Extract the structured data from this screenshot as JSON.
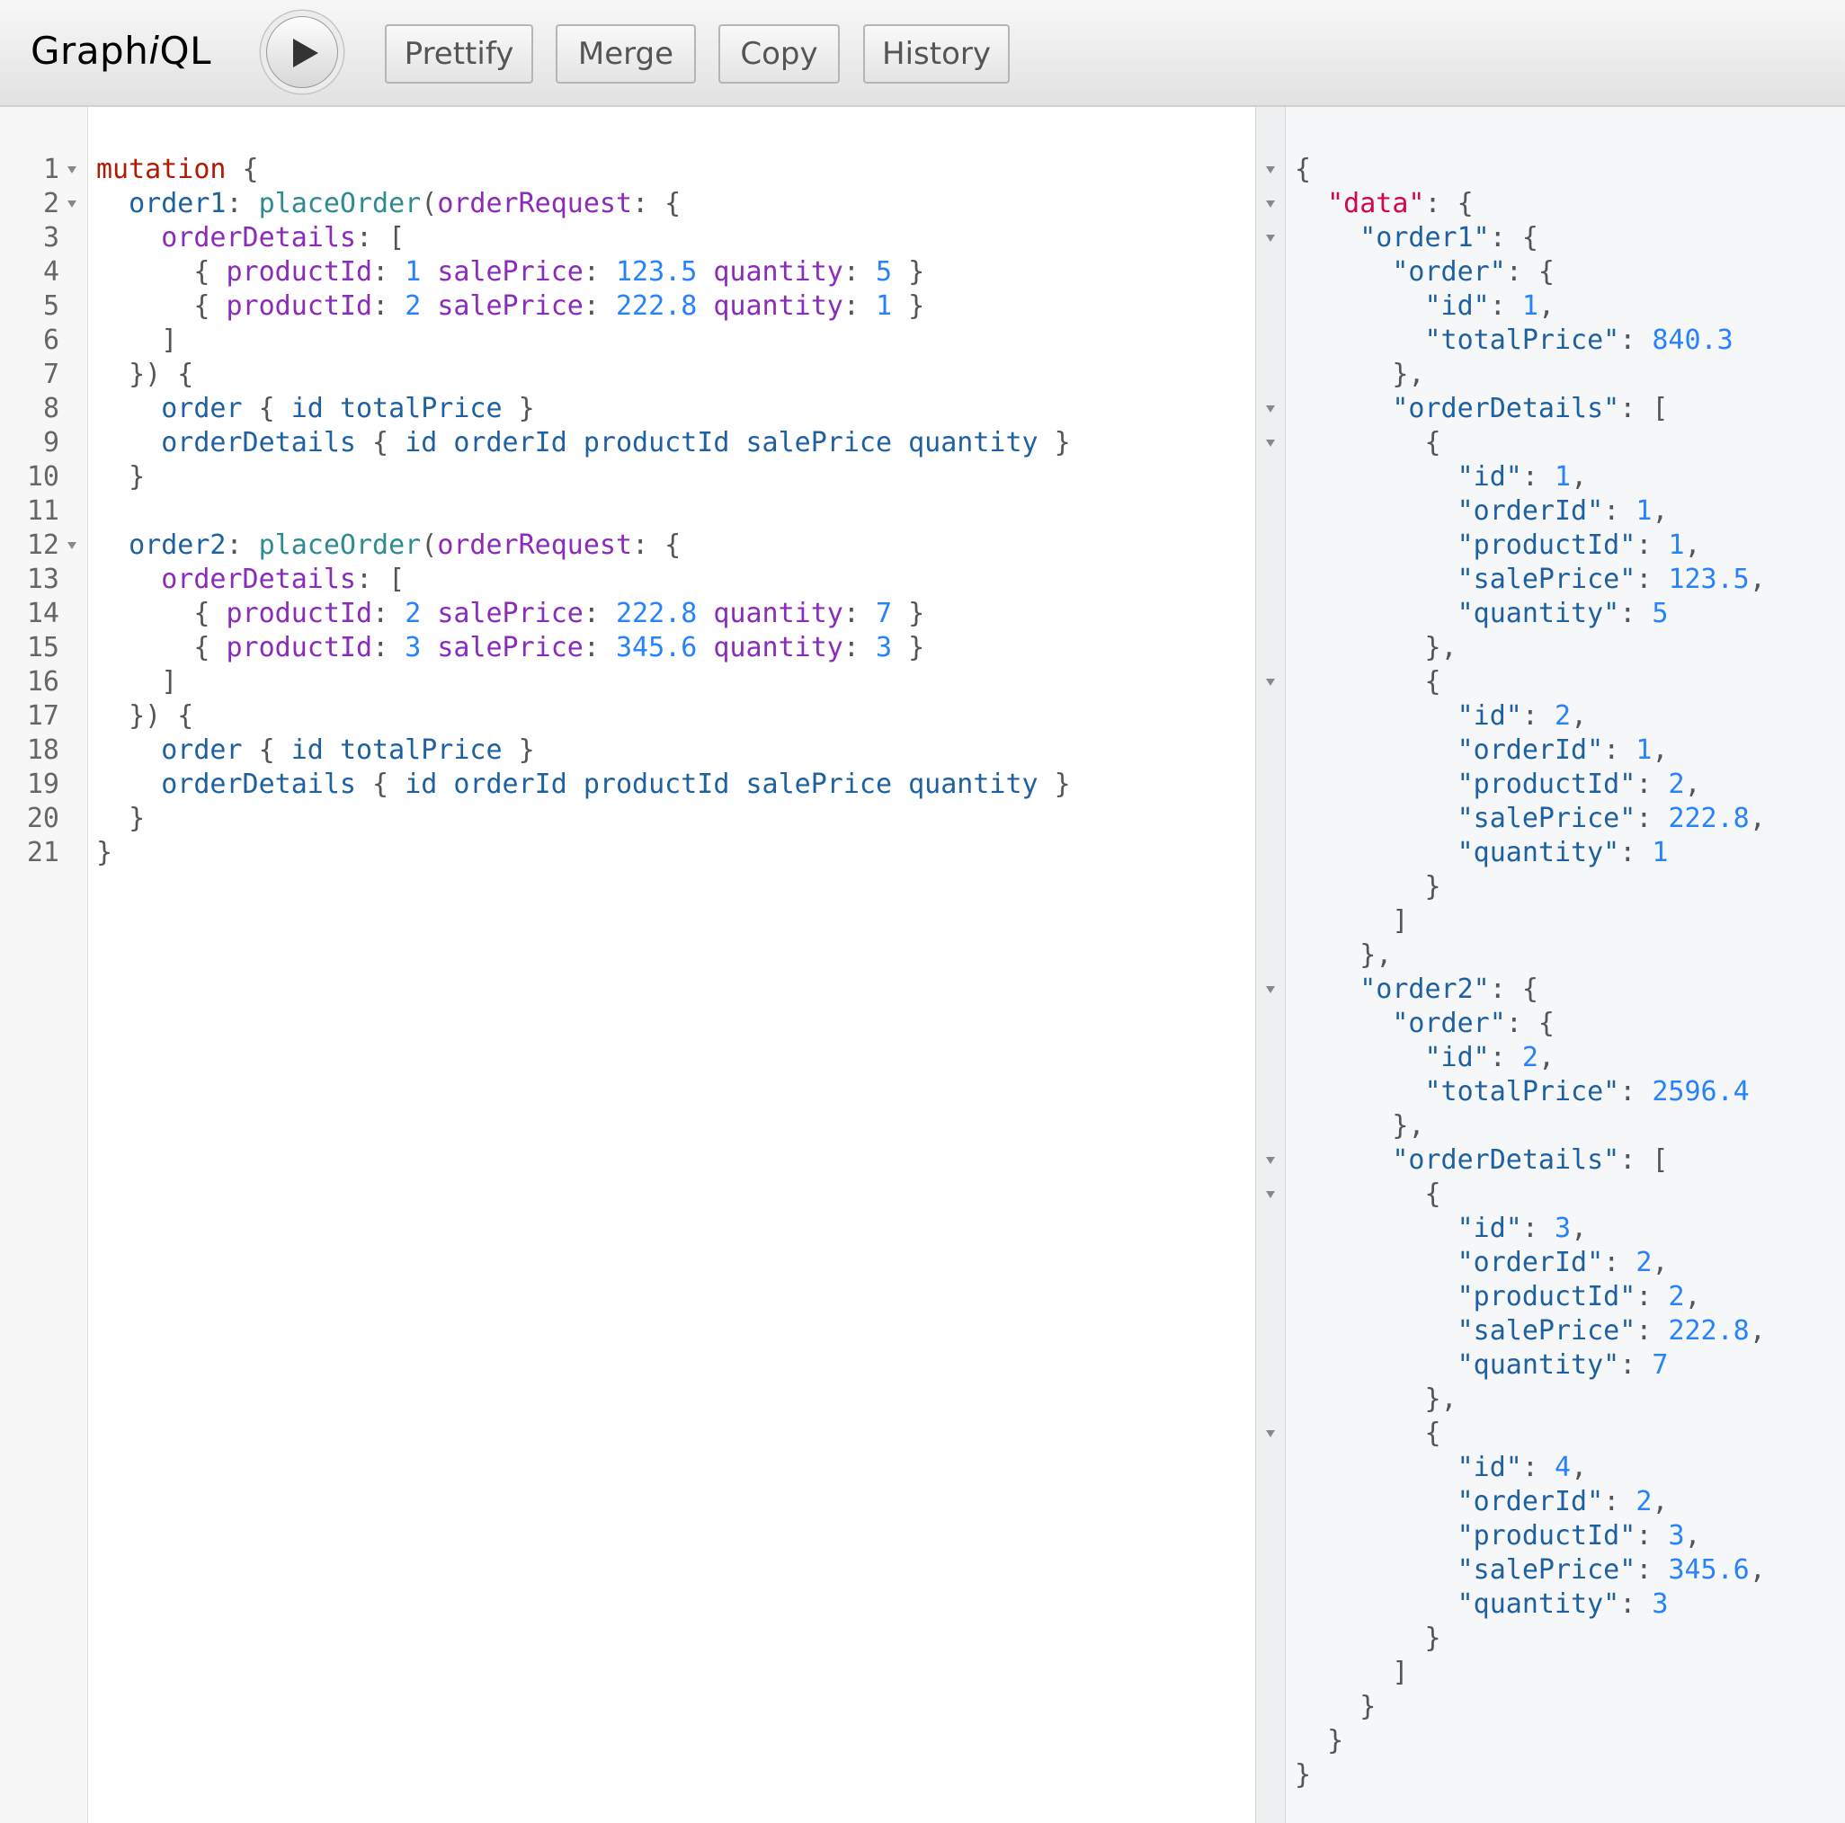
{
  "toolbar": {
    "logo_pre": "Graph",
    "logo_i": "i",
    "logo_post": "QL",
    "run_icon": "play-icon",
    "prettify": "Prettify",
    "merge": "Merge",
    "copy": "Copy",
    "history": "History"
  },
  "query_lines": [
    "mutation {",
    "  order1: placeOrder(orderRequest: {",
    "    orderDetails: [",
    "      { productId: 1 salePrice: 123.5 quantity: 5 }",
    "      { productId: 2 salePrice: 222.8 quantity: 1 }",
    "    ]",
    "  }) {",
    "    order { id totalPrice }",
    "    orderDetails { id orderId productId salePrice quantity }",
    "  }",
    "",
    "  order2: placeOrder(orderRequest: {",
    "    orderDetails: [",
    "      { productId: 2 salePrice: 222.8 quantity: 7 }",
    "      { productId: 3 salePrice: 345.6 quantity: 3 }",
    "    ]",
    "  }) {",
    "    order { id totalPrice }",
    "    orderDetails { id orderId productId salePrice quantity }",
    "  }",
    "}"
  ],
  "query_fold_lines": [
    1,
    2,
    12
  ],
  "result_lines": [
    "{",
    "  \"data\": {",
    "    \"order1\": {",
    "      \"order\": {",
    "        \"id\": 1,",
    "        \"totalPrice\": 840.3",
    "      },",
    "      \"orderDetails\": [",
    "        {",
    "          \"id\": 1,",
    "          \"orderId\": 1,",
    "          \"productId\": 1,",
    "          \"salePrice\": 123.5,",
    "          \"quantity\": 5",
    "        },",
    "        {",
    "          \"id\": 2,",
    "          \"orderId\": 1,",
    "          \"productId\": 2,",
    "          \"salePrice\": 222.8,",
    "          \"quantity\": 1",
    "        }",
    "      ]",
    "    },",
    "    \"order2\": {",
    "      \"order\": {",
    "        \"id\": 2,",
    "        \"totalPrice\": 2596.4",
    "      },",
    "      \"orderDetails\": [",
    "        {",
    "          \"id\": 3,",
    "          \"orderId\": 2,",
    "          \"productId\": 2,",
    "          \"salePrice\": 222.8,",
    "          \"quantity\": 7",
    "        },",
    "        {",
    "          \"id\": 4,",
    "          \"orderId\": 2,",
    "          \"productId\": 3,",
    "          \"salePrice\": 345.6,",
    "          \"quantity\": 3",
    "        }",
    "      ]",
    "    }",
    "  }",
    "}"
  ],
  "result_fold_lines": [
    1,
    2,
    3,
    8,
    9,
    16,
    25,
    30,
    31,
    38
  ]
}
